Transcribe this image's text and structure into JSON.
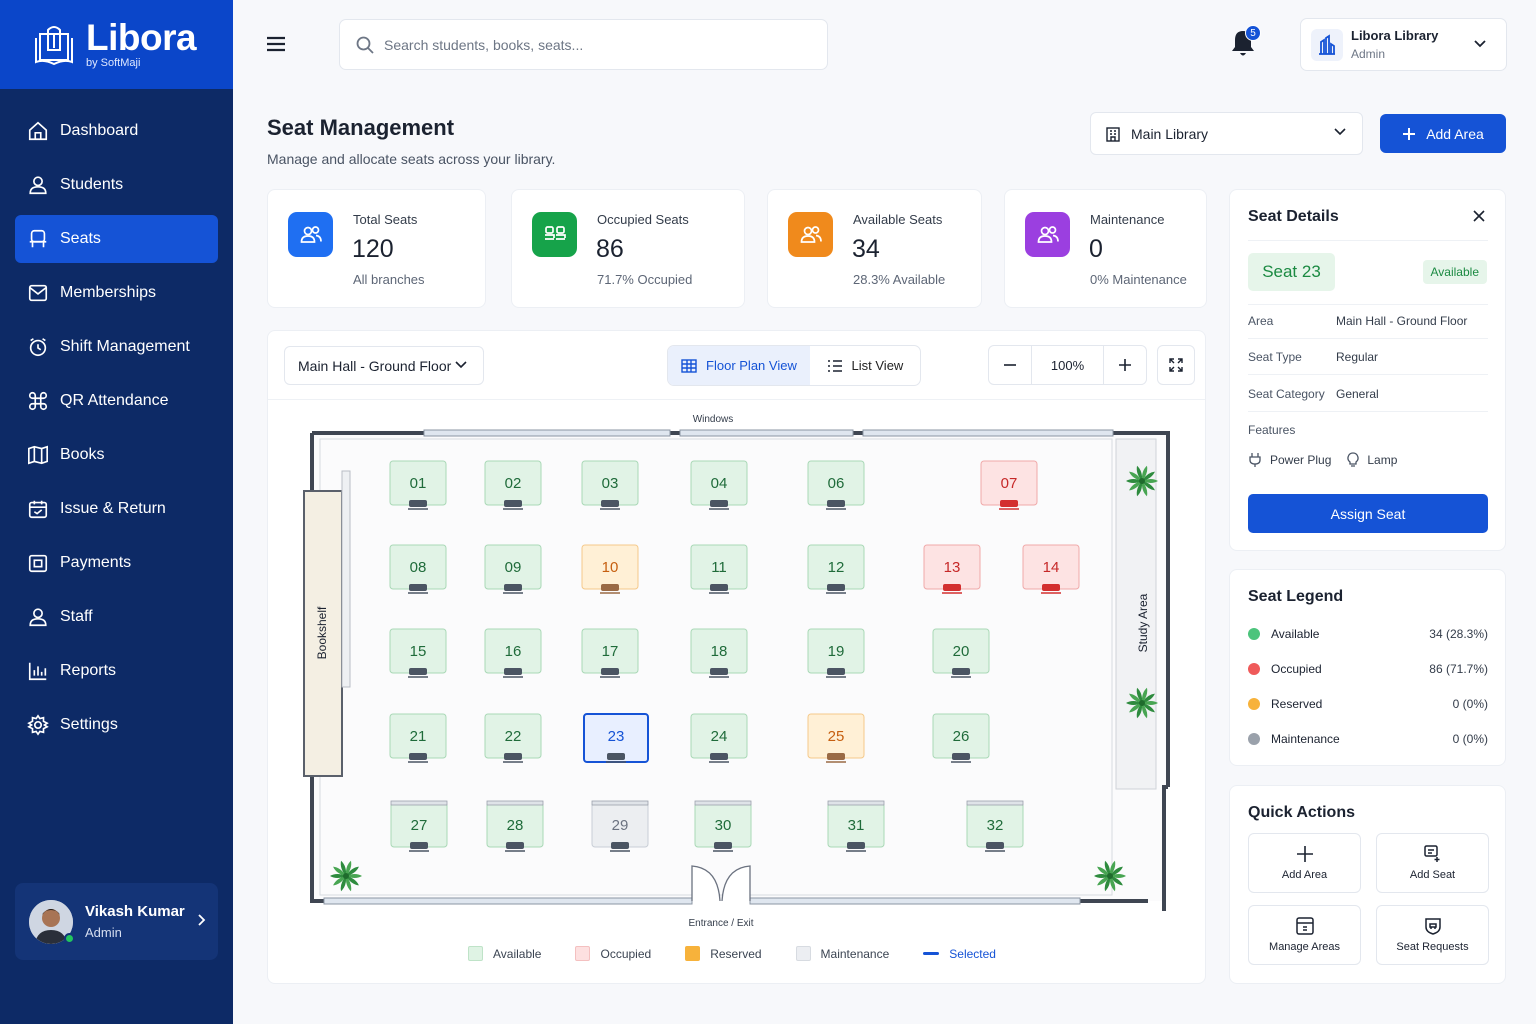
{
  "brand": {
    "name": "Libora",
    "by": "by SoftMaji"
  },
  "sidebar": {
    "items": [
      {
        "label": "Dashboard",
        "icon": "home-icon"
      },
      {
        "label": "Students",
        "icon": "user-icon"
      },
      {
        "label": "Seats",
        "icon": "chair-icon",
        "active": true
      },
      {
        "label": "Memberships",
        "icon": "mail-icon"
      },
      {
        "label": "Shift Management",
        "icon": "clock-icon"
      },
      {
        "label": "QR Attendance",
        "icon": "qr-icon"
      },
      {
        "label": "Books",
        "icon": "book-icon"
      },
      {
        "label": "Issue & Return",
        "icon": "calendar-icon"
      },
      {
        "label": "Payments",
        "icon": "wallet-icon"
      },
      {
        "label": "Staff",
        "icon": "user-icon"
      },
      {
        "label": "Reports",
        "icon": "bar-chart-icon"
      },
      {
        "label": "Settings",
        "icon": "gear-icon"
      }
    ],
    "user": {
      "name": "Vikash Kumar",
      "role": "Admin"
    }
  },
  "topbar": {
    "search_placeholder": "Search students, books, seats...",
    "notification_count": "5",
    "library": {
      "name": "Libora Library",
      "role": "Admin"
    }
  },
  "header": {
    "title": "Seat Management",
    "subtitle": "Manage and allocate seats across your library.",
    "branch": "Main Library",
    "add_area": "Add Area"
  },
  "stats": [
    {
      "label": "Total Seats",
      "value": "120",
      "sub": "All branches",
      "color": "#1f6ff2"
    },
    {
      "label": "Occupied Seats",
      "value": "86",
      "sub": "71.7% Occupied",
      "color": "#16a34a"
    },
    {
      "label": "Available Seats",
      "value": "34",
      "sub": "28.3% Available",
      "color": "#f08a1c"
    },
    {
      "label": "Maintenance",
      "value": "0",
      "sub": "0% Maintenance",
      "color": "#9b3fe0"
    }
  ],
  "floor": {
    "area": "Main Hall - Ground Floor",
    "views": {
      "floor_plan": "Floor Plan View",
      "list": "List View"
    },
    "zoom": "100%",
    "labels": {
      "windows": "Windows",
      "bookshelf": "Bookshelf",
      "study_area": "Study Area",
      "entrance": "Entrance / Exit"
    },
    "seats": [
      {
        "id": "01",
        "status": "available"
      },
      {
        "id": "02",
        "status": "available"
      },
      {
        "id": "03",
        "status": "available"
      },
      {
        "id": "04",
        "status": "available"
      },
      {
        "id": "06",
        "status": "available"
      },
      {
        "id": "07",
        "status": "occupied"
      },
      {
        "id": "08",
        "status": "available"
      },
      {
        "id": "09",
        "status": "available"
      },
      {
        "id": "10",
        "status": "reserved"
      },
      {
        "id": "11",
        "status": "available"
      },
      {
        "id": "12",
        "status": "available"
      },
      {
        "id": "13",
        "status": "occupied"
      },
      {
        "id": "14",
        "status": "occupied"
      },
      {
        "id": "15",
        "status": "available"
      },
      {
        "id": "16",
        "status": "available"
      },
      {
        "id": "17",
        "status": "available"
      },
      {
        "id": "18",
        "status": "available"
      },
      {
        "id": "19",
        "status": "available"
      },
      {
        "id": "20",
        "status": "available"
      },
      {
        "id": "21",
        "status": "available"
      },
      {
        "id": "22",
        "status": "available"
      },
      {
        "id": "23",
        "status": "selected"
      },
      {
        "id": "24",
        "status": "available"
      },
      {
        "id": "25",
        "status": "reserved"
      },
      {
        "id": "26",
        "status": "available"
      },
      {
        "id": "27",
        "status": "available"
      },
      {
        "id": "28",
        "status": "available"
      },
      {
        "id": "29",
        "status": "maintenance"
      },
      {
        "id": "30",
        "status": "available"
      },
      {
        "id": "31",
        "status": "available"
      },
      {
        "id": "32",
        "status": "available"
      }
    ],
    "legend": [
      {
        "label": "Available",
        "color": "#dff3e4"
      },
      {
        "label": "Occupied",
        "color": "#fde0e0"
      },
      {
        "label": "Reserved",
        "color": "#f7b23b"
      },
      {
        "label": "Maintenance",
        "color": "#eceef2"
      },
      {
        "label": "Selected",
        "color": "#1553d6"
      }
    ]
  },
  "seat_details": {
    "title": "Seat Details",
    "seat": "Seat 23",
    "status": "Available",
    "rows": [
      {
        "key": "Area",
        "value": "Main Hall - Ground Floor"
      },
      {
        "key": "Seat Type",
        "value": "Regular"
      },
      {
        "key": "Seat Category",
        "value": "General"
      }
    ],
    "features_label": "Features",
    "features": [
      "Power Plug",
      "Lamp"
    ],
    "assign": "Assign Seat"
  },
  "seat_legend": {
    "title": "Seat Legend",
    "items": [
      {
        "label": "Available",
        "count": "34 (28.3%)",
        "color": "#4cc47c"
      },
      {
        "label": "Occupied",
        "count": "86 (71.7%)",
        "color": "#ef5a5a"
      },
      {
        "label": "Reserved",
        "count": "0 (0%)",
        "color": "#f7b23b"
      },
      {
        "label": "Maintenance",
        "count": "0 (0%)",
        "color": "#9aa1ab"
      }
    ]
  },
  "quick_actions": {
    "title": "Quick Actions",
    "items": [
      "Add Area",
      "Add Seat",
      "Manage Areas",
      "Seat Requests"
    ]
  }
}
